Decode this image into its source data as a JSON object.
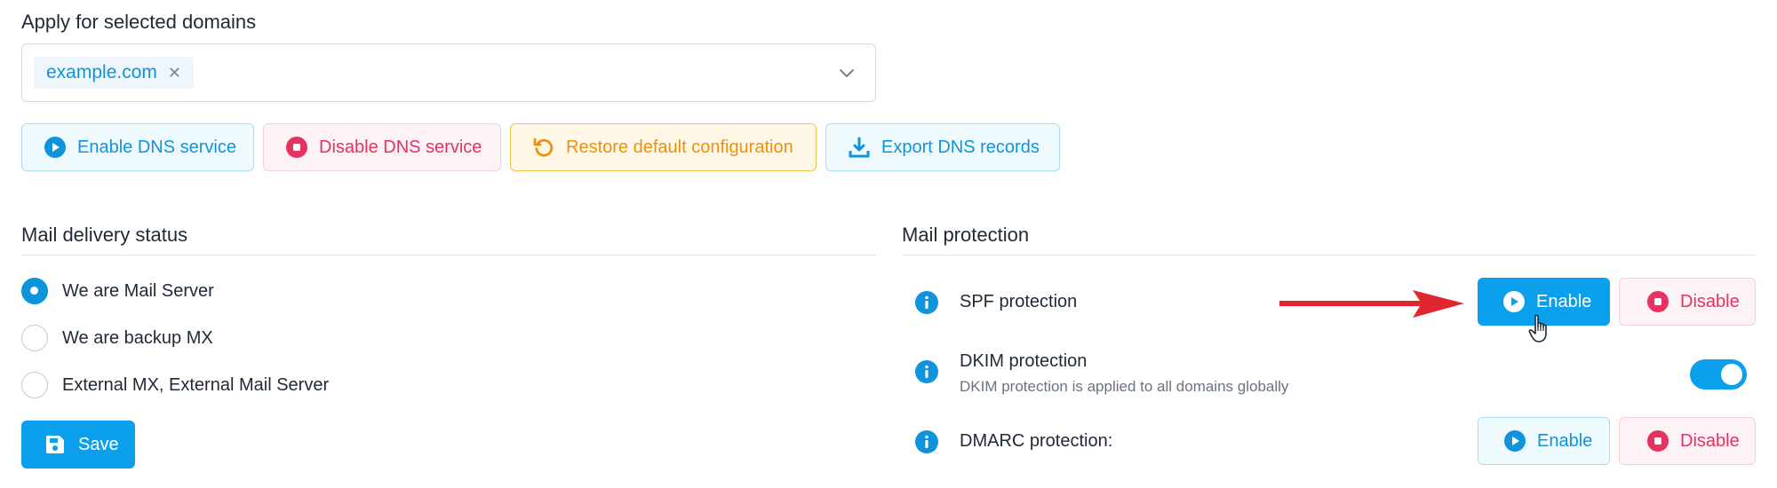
{
  "domains": {
    "title": "Apply for selected domains",
    "selected": [
      "example.com"
    ]
  },
  "actions": {
    "enable_dns": "Enable DNS service",
    "disable_dns": "Disable DNS service",
    "restore_default": "Restore default configuration",
    "export_dns": "Export DNS records"
  },
  "delivery": {
    "title": "Mail delivery status",
    "options": [
      {
        "label": "We are Mail Server",
        "checked": true
      },
      {
        "label": "We are backup MX",
        "checked": false
      },
      {
        "label": "External MX, External Mail Server",
        "checked": false
      }
    ],
    "save_label": "Save"
  },
  "protection": {
    "title": "Mail protection",
    "spf": {
      "label": "SPF protection",
      "enable": "Enable",
      "disable": "Disable"
    },
    "dkim": {
      "label": "DKIM protection",
      "note": "DKIM protection is applied to all domains globally",
      "enabled": true
    },
    "dmarc": {
      "label": "DMARC protection:",
      "enable": "Enable",
      "disable": "Disable"
    }
  },
  "colors": {
    "primary": "#0ca0ec",
    "danger": "#e5325f",
    "warning": "#f08f0b",
    "arrow": "#e0262e"
  }
}
